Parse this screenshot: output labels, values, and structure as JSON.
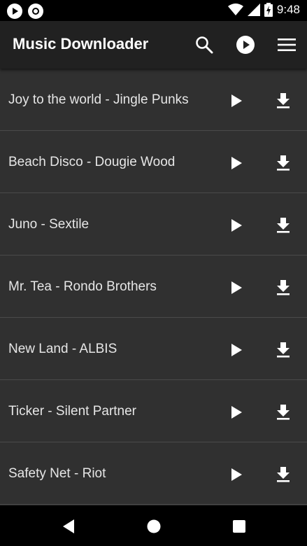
{
  "status_bar": {
    "time": "9:48",
    "icons": [
      "play-notification-icon",
      "record-notification-icon",
      "wifi-icon",
      "signal-icon",
      "battery-charging-icon"
    ]
  },
  "app_bar": {
    "title": "Music Downloader",
    "actions": [
      "search-icon",
      "play-circle-icon",
      "menu-icon"
    ]
  },
  "songs": [
    {
      "title": "Joy to the world - Jingle Punks"
    },
    {
      "title": "Beach Disco - Dougie Wood"
    },
    {
      "title": "Juno - Sextile"
    },
    {
      "title": "Mr. Tea - Rondo Brothers"
    },
    {
      "title": "New Land - ALBIS"
    },
    {
      "title": "Ticker - Silent Partner"
    },
    {
      "title": "Safety Net - Riot"
    }
  ],
  "nav_bar": {
    "buttons": [
      "back-icon",
      "home-icon",
      "recents-icon"
    ]
  },
  "colors": {
    "app_bar": "#212121",
    "list_background": "#303030",
    "divider": "#4a4a4a",
    "text": "#e6e6e6"
  }
}
